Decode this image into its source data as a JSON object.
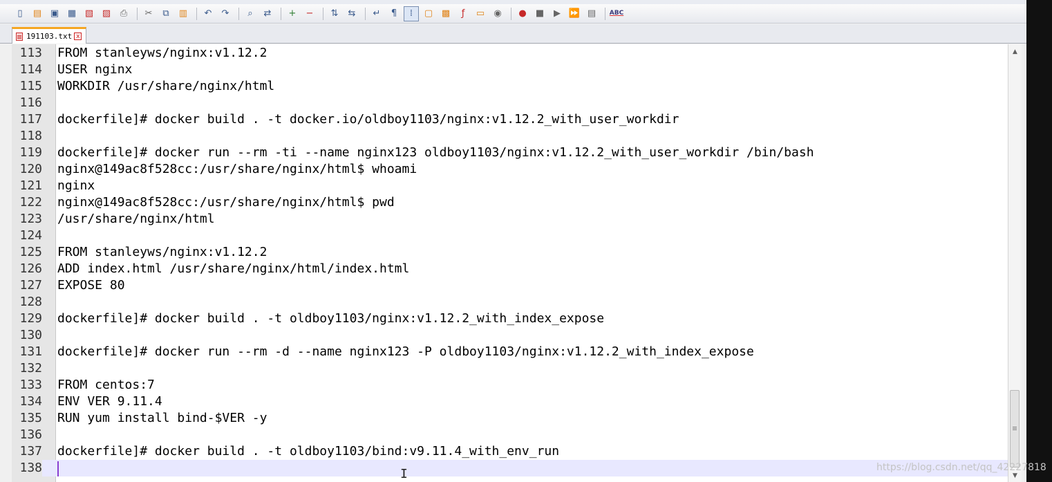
{
  "tab": {
    "title": "191103.txt",
    "close": "x"
  },
  "editor": {
    "lines": [
      {
        "num": "113",
        "text": "FROM stanleyws/nginx:v1.12.2"
      },
      {
        "num": "114",
        "text": "USER nginx"
      },
      {
        "num": "115",
        "text": "WORKDIR /usr/share/nginx/html"
      },
      {
        "num": "116",
        "text": ""
      },
      {
        "num": "117",
        "text": "dockerfile]# docker build . -t docker.io/oldboy1103/nginx:v1.12.2_with_user_workdir"
      },
      {
        "num": "118",
        "text": ""
      },
      {
        "num": "119",
        "text": "dockerfile]# docker run --rm -ti --name nginx123 oldboy1103/nginx:v1.12.2_with_user_workdir /bin/bash"
      },
      {
        "num": "120",
        "text": "nginx@149ac8f528cc:/usr/share/nginx/html$ whoami"
      },
      {
        "num": "121",
        "text": "nginx"
      },
      {
        "num": "122",
        "text": "nginx@149ac8f528cc:/usr/share/nginx/html$ pwd"
      },
      {
        "num": "123",
        "text": "/usr/share/nginx/html"
      },
      {
        "num": "124",
        "text": ""
      },
      {
        "num": "125",
        "text": "FROM stanleyws/nginx:v1.12.2"
      },
      {
        "num": "126",
        "text": "ADD index.html /usr/share/nginx/html/index.html"
      },
      {
        "num": "127",
        "text": "EXPOSE 80"
      },
      {
        "num": "128",
        "text": ""
      },
      {
        "num": "129",
        "text": "dockerfile]# docker build . -t oldboy1103/nginx:v1.12.2_with_index_expose"
      },
      {
        "num": "130",
        "text": ""
      },
      {
        "num": "131",
        "text": "dockerfile]# docker run --rm -d --name nginx123 -P oldboy1103/nginx:v1.12.2_with_index_expose"
      },
      {
        "num": "132",
        "text": ""
      },
      {
        "num": "133",
        "text": "FROM centos:7"
      },
      {
        "num": "134",
        "text": "ENV VER 9.11.4"
      },
      {
        "num": "135",
        "text": "RUN yum install bind-$VER -y"
      },
      {
        "num": "136",
        "text": ""
      },
      {
        "num": "137",
        "text": "dockerfile]# docker build . -t oldboy1103/bind:v9.11.4_with_env_run"
      },
      {
        "num": "138",
        "text": ""
      }
    ]
  },
  "scrollbar": {
    "up_glyph": "▲",
    "down_glyph": "▼"
  },
  "cursor": {
    "glyph": "I"
  },
  "watermark": "https://blog.csdn.net/qq_42227818",
  "toolbar": {
    "icons": [
      {
        "name": "new-file-icon",
        "glyph": "▯"
      },
      {
        "name": "open-file-icon",
        "glyph": "▤"
      },
      {
        "name": "save-icon",
        "glyph": "▣"
      },
      {
        "name": "save-all-icon",
        "glyph": "▦"
      },
      {
        "name": "close-icon",
        "glyph": "▧"
      },
      {
        "name": "close-all-icon",
        "glyph": "▨"
      },
      {
        "name": "print-icon",
        "glyph": "⎙"
      },
      {
        "name": "cut-icon",
        "glyph": "✂"
      },
      {
        "name": "copy-icon",
        "glyph": "⧉"
      },
      {
        "name": "paste-icon",
        "glyph": "▥"
      },
      {
        "name": "undo-icon",
        "glyph": "↶"
      },
      {
        "name": "redo-icon",
        "glyph": "↷"
      },
      {
        "name": "find-icon",
        "glyph": "⌕"
      },
      {
        "name": "replace-icon",
        "glyph": "⇄"
      },
      {
        "name": "zoom-in-icon",
        "glyph": "+"
      },
      {
        "name": "zoom-out-icon",
        "glyph": "−"
      },
      {
        "name": "sync-vertical-icon",
        "glyph": "⇅"
      },
      {
        "name": "sync-horizontal-icon",
        "glyph": "⇆"
      },
      {
        "name": "word-wrap-icon",
        "glyph": "↵"
      },
      {
        "name": "show-all-chars-icon",
        "glyph": "¶"
      },
      {
        "name": "indent-guide-icon",
        "glyph": "⁞"
      },
      {
        "name": "udl-icon",
        "glyph": "▢"
      },
      {
        "name": "doc-map-icon",
        "glyph": "▩"
      },
      {
        "name": "function-list-icon",
        "glyph": "ƒ"
      },
      {
        "name": "folder-workspace-icon",
        "glyph": "▭"
      },
      {
        "name": "monitor-icon",
        "glyph": "◉"
      },
      {
        "name": "record-macro-icon",
        "glyph": "●"
      },
      {
        "name": "stop-macro-icon",
        "glyph": "■"
      },
      {
        "name": "play-macro-icon",
        "glyph": "▶"
      },
      {
        "name": "run-macro-multiple-icon",
        "glyph": "⏩"
      },
      {
        "name": "save-macro-icon",
        "glyph": "▤"
      },
      {
        "name": "spell-check-icon",
        "glyph": "ABC"
      }
    ]
  }
}
